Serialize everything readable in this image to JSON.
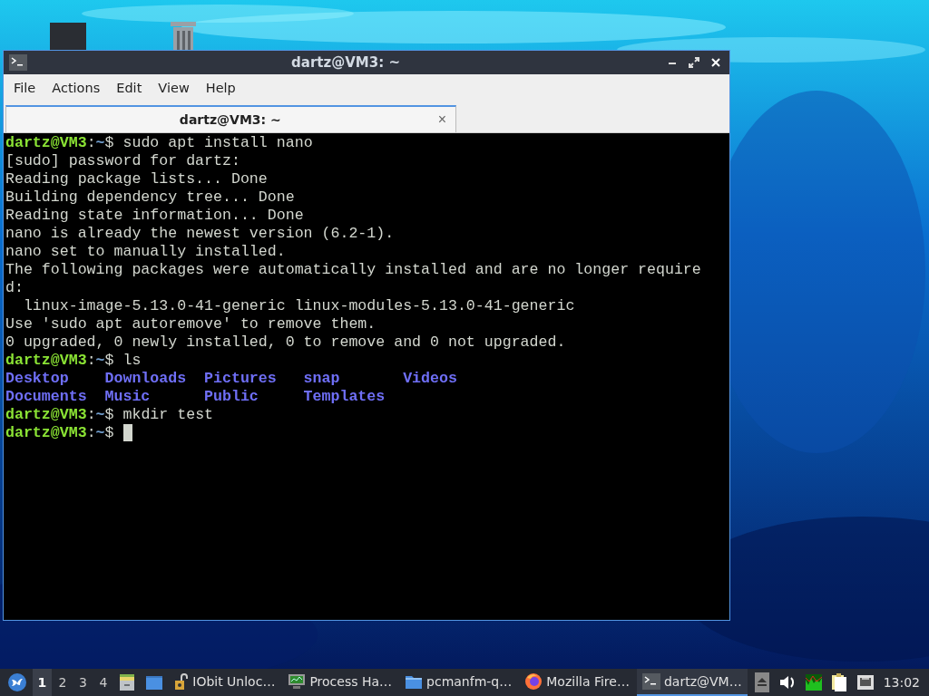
{
  "desktop": {
    "icons": [
      {
        "kind": "folder"
      },
      {
        "kind": "trash"
      }
    ]
  },
  "window": {
    "title": "dartz@VM3: ~",
    "menu": [
      "File",
      "Actions",
      "Edit",
      "View",
      "Help"
    ],
    "tabs": [
      {
        "label": "dartz@VM3: ~",
        "selected": true,
        "close": "×"
      }
    ],
    "terminal": [
      {
        "kind": "prompt",
        "user": "dartz@VM3",
        "separator": ":",
        "path": "~",
        "symbol": "$",
        "command": " sudo apt install nano",
        "cursor": false
      },
      {
        "kind": "text",
        "text": "[sudo] password for dartz:"
      },
      {
        "kind": "text",
        "text": "Reading package lists... Done"
      },
      {
        "kind": "text",
        "text": "Building dependency tree... Done"
      },
      {
        "kind": "text",
        "text": "Reading state information... Done"
      },
      {
        "kind": "text",
        "text": "nano is already the newest version (6.2-1)."
      },
      {
        "kind": "text",
        "text": "nano set to manually installed."
      },
      {
        "kind": "text",
        "text": "The following packages were automatically installed and are no longer require"
      },
      {
        "kind": "text",
        "text": "d:"
      },
      {
        "kind": "text",
        "text": "  linux-image-5.13.0-41-generic linux-modules-5.13.0-41-generic"
      },
      {
        "kind": "text",
        "text": "Use 'sudo apt autoremove' to remove them."
      },
      {
        "kind": "text",
        "text": "0 upgraded, 0 newly installed, 0 to remove and 0 not upgraded."
      },
      {
        "kind": "prompt",
        "user": "dartz@VM3",
        "separator": ":",
        "path": "~",
        "symbol": "$",
        "command": " ls",
        "cursor": false
      },
      {
        "kind": "listing",
        "items": [
          "Desktop",
          "Downloads",
          "Pictures",
          "snap",
          "Videos"
        ]
      },
      {
        "kind": "listing",
        "items": [
          "Documents",
          "Music",
          "Public",
          "Templates"
        ]
      },
      {
        "kind": "prompt",
        "user": "dartz@VM3",
        "separator": ":",
        "path": "~",
        "symbol": "$",
        "command": " mkdir test",
        "cursor": false
      },
      {
        "kind": "prompt",
        "user": "dartz@VM3",
        "separator": ":",
        "path": "~",
        "symbol": "$",
        "cursor": true
      }
    ]
  },
  "taskbar": {
    "workspaces": [
      {
        "label": "1",
        "selected": true
      },
      {
        "label": "2",
        "selected": false
      },
      {
        "label": "3",
        "selected": false
      },
      {
        "label": "4",
        "selected": false
      }
    ],
    "launchers": [
      {
        "kind": "cabinet"
      },
      {
        "kind": "window"
      }
    ],
    "tasks": [
      {
        "kind": "lock",
        "label": "IObit Unloc…",
        "selected": false
      },
      {
        "kind": "monitor",
        "label": "Process Ha…",
        "selected": false
      },
      {
        "kind": "folder",
        "label": "pcmanfm-q…",
        "selected": false
      },
      {
        "kind": "browser",
        "label": "Mozilla Fire…",
        "selected": false
      },
      {
        "kind": "terminal",
        "label": "dartz@VM…",
        "selected": true
      }
    ],
    "tray": [
      {
        "kind": "eject"
      },
      {
        "kind": "volume"
      },
      {
        "kind": "graph"
      },
      {
        "kind": "notes"
      },
      {
        "kind": "network"
      }
    ],
    "clock": "13:02"
  }
}
